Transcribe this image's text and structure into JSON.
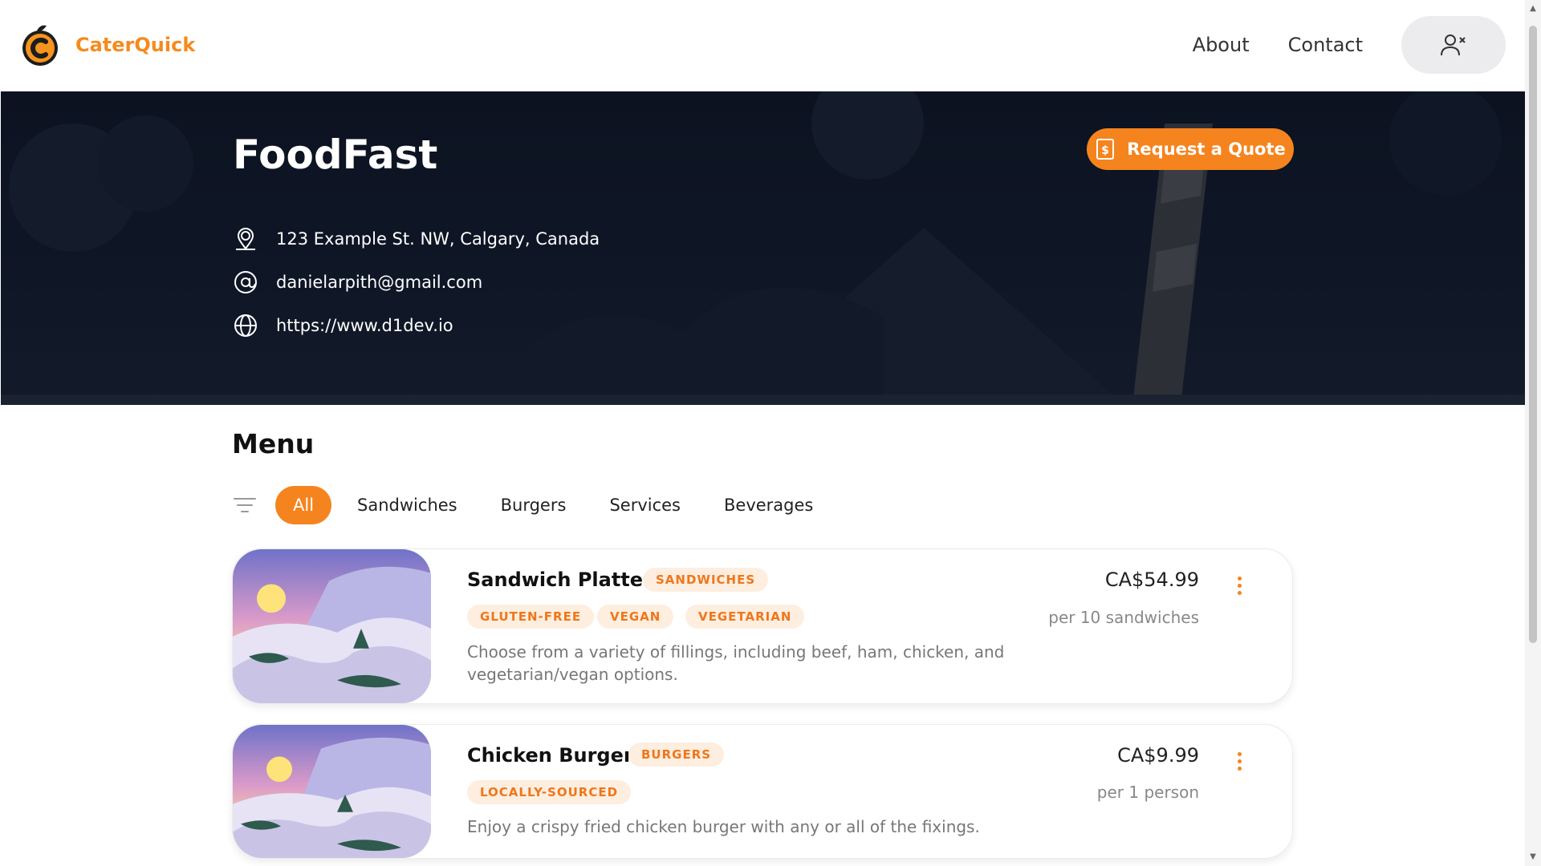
{
  "brand": {
    "name": "CaterQuick",
    "accent": "#f5841e"
  },
  "nav": {
    "about": "About",
    "contact": "Contact"
  },
  "hero": {
    "title": "FoodFast",
    "quote_button": "Request a Quote",
    "address": "123 Example St. NW, Calgary, Canada",
    "email": "danielarpith@gmail.com",
    "website": "https://www.d1dev.io"
  },
  "menu": {
    "title": "Menu",
    "filters": [
      "All",
      "Sandwiches",
      "Burgers",
      "Services",
      "Beverages"
    ],
    "active_filter": "All",
    "items": [
      {
        "name": "Sandwich Platter",
        "category": "SANDWICHES",
        "tags": [
          "GLUTEN-FREE",
          "VEGAN",
          "VEGETARIAN"
        ],
        "description": "Choose from a variety of fillings, including beef, ham, chicken, and vegetarian/vegan options.",
        "price": "CA$54.99",
        "unit": "per 10 sandwiches"
      },
      {
        "name": "Chicken Burger",
        "category": "BURGERS",
        "tags": [
          "LOCALLY-SOURCED"
        ],
        "description": "Enjoy a crispy fried chicken burger with any or all of the fixings.",
        "price": "CA$9.99",
        "unit": "per 1 person"
      }
    ]
  },
  "icons": {
    "logo": "caterquick-logo-icon",
    "user": "user-remove-icon",
    "location": "location-pin-icon",
    "email": "at-sign-icon",
    "web": "globe-icon",
    "quote": "dollar-document-icon",
    "filter": "filter-icon",
    "more": "kebab-menu-icon"
  }
}
